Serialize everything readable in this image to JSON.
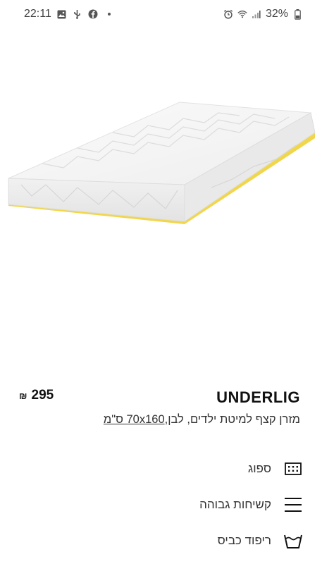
{
  "status": {
    "time": "22:11",
    "battery": "32%",
    "left_icons": [
      "gallery-icon",
      "usb-icon",
      "facebook-icon"
    ],
    "right_icons": [
      "alarm-icon",
      "wifi-icon",
      "signal-icon",
      "battery-icon"
    ]
  },
  "product": {
    "name": "UNDERLIG",
    "price": "295",
    "currency": "₪",
    "description_prefix": "מזרן קצף למיטת ילדים, לבן,",
    "description_size": "70x160 ס\"מ"
  },
  "features": [
    {
      "label": "ספוג",
      "icon": "foam-grid-icon"
    },
    {
      "label": "קשיחות גבוהה",
      "icon": "firmness-lines-icon"
    },
    {
      "label": "ריפוד כביס",
      "icon": "washable-tub-icon"
    }
  ],
  "colors": {
    "text": "#111111",
    "muted": "#333333",
    "accent_yellow": "#f2d64a"
  }
}
